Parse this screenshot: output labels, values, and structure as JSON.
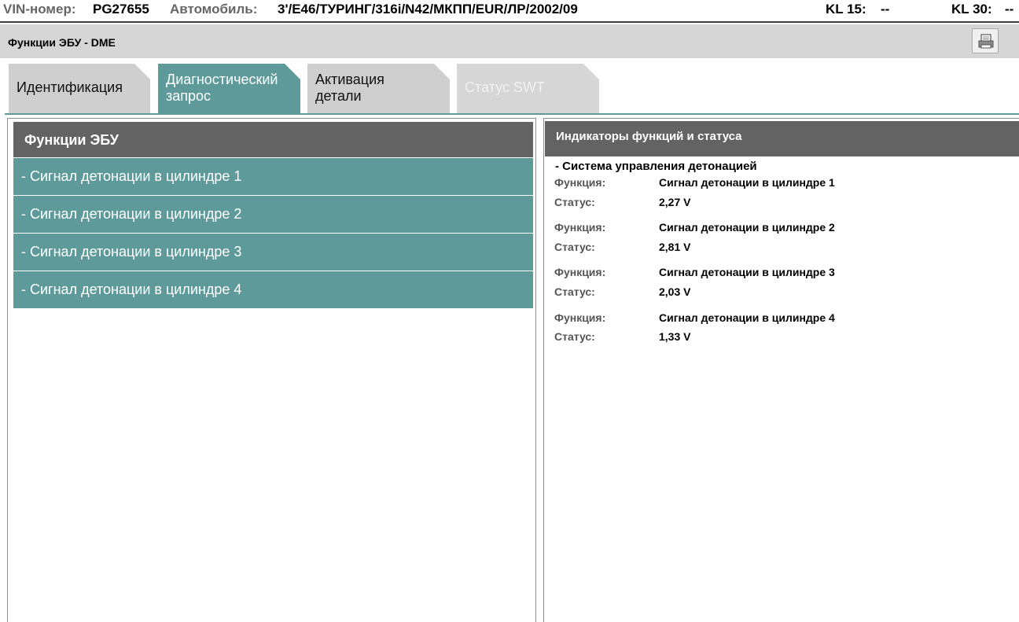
{
  "header": {
    "vin_label": "VIN-номер:",
    "vin_value": "PG27655",
    "car_label": "Автомобиль:",
    "car_value": "3'/E46/ТУРИНГ/316i/N42/МКПП/EUR/ЛР/2002/09",
    "kl15_label": "KL 15:",
    "kl15_value": "--",
    "kl30_label": "KL 30:",
    "kl30_value": "--"
  },
  "title": "Функции ЭБУ - DME",
  "print_icon": "printer-icon",
  "tabs": [
    {
      "line1": "Идентификация",
      "line2": "",
      "state": "normal"
    },
    {
      "line1": "Диагностический",
      "line2": "запрос",
      "state": "active"
    },
    {
      "line1": "Активация",
      "line2": "детали",
      "state": "normal"
    },
    {
      "line1": "Статус SWT",
      "line2": "",
      "state": "disabled"
    }
  ],
  "left_panel": {
    "header": "Функции ЭБУ",
    "items": [
      "- Сигнал детонации в цилиндре 1",
      "- Сигнал детонации в цилиндре 2",
      "- Сигнал детонации в цилиндре 3",
      "- Сигнал детонации в цилиндре 4"
    ]
  },
  "right_panel": {
    "header": "Индикаторы функций и статуса",
    "group": "- Система управления детонацией",
    "function_label": "Функция:",
    "status_label": "Статус:",
    "entries": [
      {
        "function": "Сигнал детонации в цилиндре 1",
        "status": "2,27  V"
      },
      {
        "function": "Сигнал детонации в цилиндре 2",
        "status": "2,81  V"
      },
      {
        "function": "Сигнал детонации в цилиндре 3",
        "status": "2,03  V"
      },
      {
        "function": "Сигнал детонации в цилиндре 4",
        "status": "1,33  V"
      }
    ]
  },
  "colors": {
    "accent": "#5f9a9a",
    "header_dark": "#636363",
    "title_bar": "#d6d6d6"
  }
}
